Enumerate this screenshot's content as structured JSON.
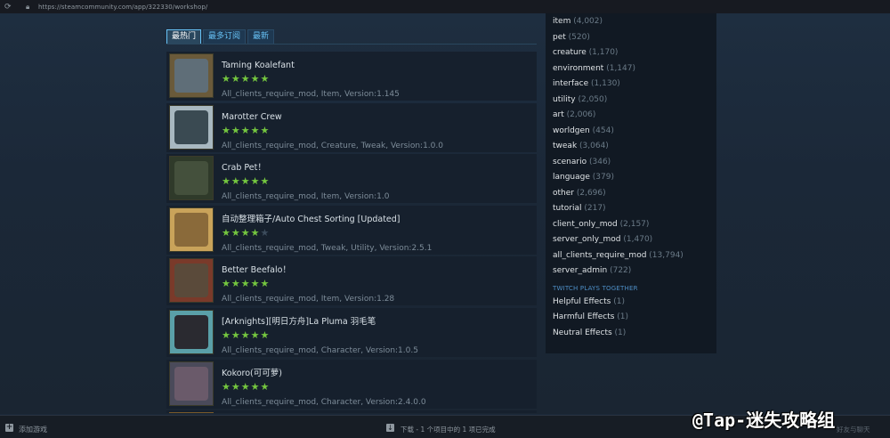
{
  "browser": {
    "url": "https://steamcommunity.com/app/322330/workshop/"
  },
  "tabs": [
    {
      "label": "最热门",
      "active": true
    },
    {
      "label": "最多订阅",
      "active": false
    },
    {
      "label": "最新",
      "active": false
    }
  ],
  "items": [
    {
      "title": "Taming Koalefant",
      "rating": 5,
      "tags": "All_clients_require_mod, Item, Version:1.145",
      "thumb_color": "#6a5a3a",
      "thumb_inner": "#5f6e78"
    },
    {
      "title": "Marotter Crew",
      "rating": 5,
      "tags": "All_clients_require_mod, Creature, Tweak, Version:1.0.0",
      "thumb_color": "#a8b8c0",
      "thumb_inner": "#3a4a52"
    },
    {
      "title": "Crab Pet！",
      "rating": 5,
      "tags": "All_clients_require_mod, Item, Version:1.0",
      "thumb_color": "#2f3a2a",
      "thumb_inner": "#44503c"
    },
    {
      "title": "自动整理箱子/Auto Chest Sorting [Updated]",
      "rating": 4,
      "tags": "All_clients_require_mod, Tweak, Utility, Version:2.5.1",
      "thumb_color": "#c9a35a",
      "thumb_inner": "#8a6a3a"
    },
    {
      "title": "Better Beefalo！",
      "rating": 5,
      "tags": "All_clients_require_mod, Item, Version:1.28",
      "thumb_color": "#7a3a2a",
      "thumb_inner": "#5a4a3a"
    },
    {
      "title": "[Arknights][明日方舟]La Pluma 羽毛笔",
      "rating": 5,
      "tags": "All_clients_require_mod, Character, Version:1.0.5",
      "thumb_color": "#5aa0a8",
      "thumb_inner": "#2a2a30"
    },
    {
      "title": "Kokoro(可可萝)",
      "rating": 5,
      "tags": "All_clients_require_mod, Character, Version:2.4.0.0",
      "thumb_color": "#4a4a5a",
      "thumb_inner": "#6a5a6a"
    }
  ],
  "sidebar": {
    "tags": [
      {
        "name": "item",
        "count": "(4,002)"
      },
      {
        "name": "pet",
        "count": "(520)"
      },
      {
        "name": "creature",
        "count": "(1,170)"
      },
      {
        "name": "environment",
        "count": "(1,147)"
      },
      {
        "name": "interface",
        "count": "(1,130)"
      },
      {
        "name": "utility",
        "count": "(2,050)"
      },
      {
        "name": "art",
        "count": "(2,006)"
      },
      {
        "name": "worldgen",
        "count": "(454)"
      },
      {
        "name": "tweak",
        "count": "(3,064)"
      },
      {
        "name": "scenario",
        "count": "(346)"
      },
      {
        "name": "language",
        "count": "(379)"
      },
      {
        "name": "other",
        "count": "(2,696)"
      },
      {
        "name": "tutorial",
        "count": "(217)"
      },
      {
        "name": "client_only_mod",
        "count": "(2,157)"
      },
      {
        "name": "server_only_mod",
        "count": "(1,470)"
      },
      {
        "name": "all_clients_require_mod",
        "count": "(13,794)"
      },
      {
        "name": "server_admin",
        "count": "(722)"
      }
    ],
    "section_title": "TWITCH PLAYS TOGETHER",
    "twitch_tags": [
      {
        "name": "Helpful Effects",
        "count": "(1)"
      },
      {
        "name": "Harmful Effects",
        "count": "(1)"
      },
      {
        "name": "Neutral Effects",
        "count": "(1)"
      }
    ]
  },
  "bottom": {
    "add_game": "添加游戏",
    "download_status": "下载 - 1 个项目中的 1 项已完成",
    "friends": "好友与聊天"
  },
  "watermark": "@Tap-迷失攻略组"
}
